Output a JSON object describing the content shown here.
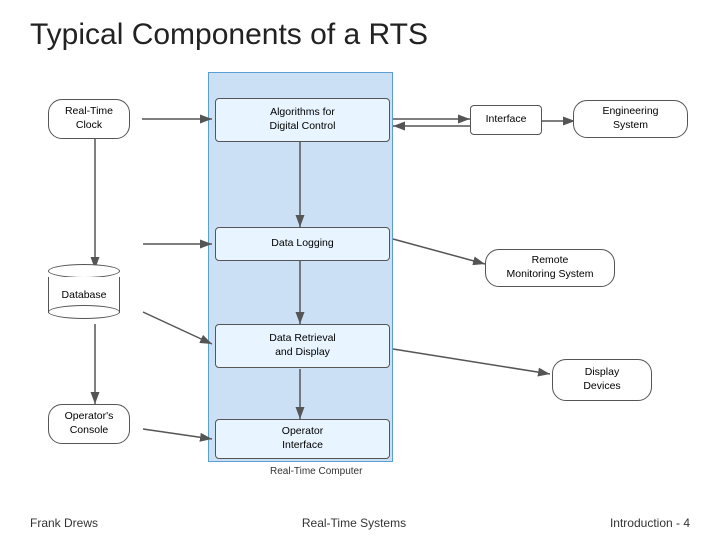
{
  "title": "Typical Components of a RTS",
  "boxes": {
    "realTimeClock": {
      "label": "Real-Time\nClock"
    },
    "algorithmsForDigitalControl": {
      "label": "Algorithms for\nDigital Control"
    },
    "interface": {
      "label": "Interface"
    },
    "engineeringSystem": {
      "label": "Engineering\nSystem"
    },
    "dataLogging": {
      "label": "Data Logging"
    },
    "remoteMonitoringSystem": {
      "label": "Remote\nMonitoring System"
    },
    "database": {
      "label": "Database"
    },
    "dataRetrievalAndDisplay": {
      "label": "Data Retrieval\nand Display"
    },
    "displayDevices": {
      "label": "Display\nDevices"
    },
    "operatorsConsole": {
      "label": "Operator's\nConsole"
    },
    "operatorInterface": {
      "label": "Operator\nInterface"
    },
    "realTimeComputer": {
      "label": "Real-Time Computer"
    }
  },
  "footer": {
    "left": "Frank Drews",
    "center": "Real-Time Systems",
    "right": "Introduction - 4"
  }
}
